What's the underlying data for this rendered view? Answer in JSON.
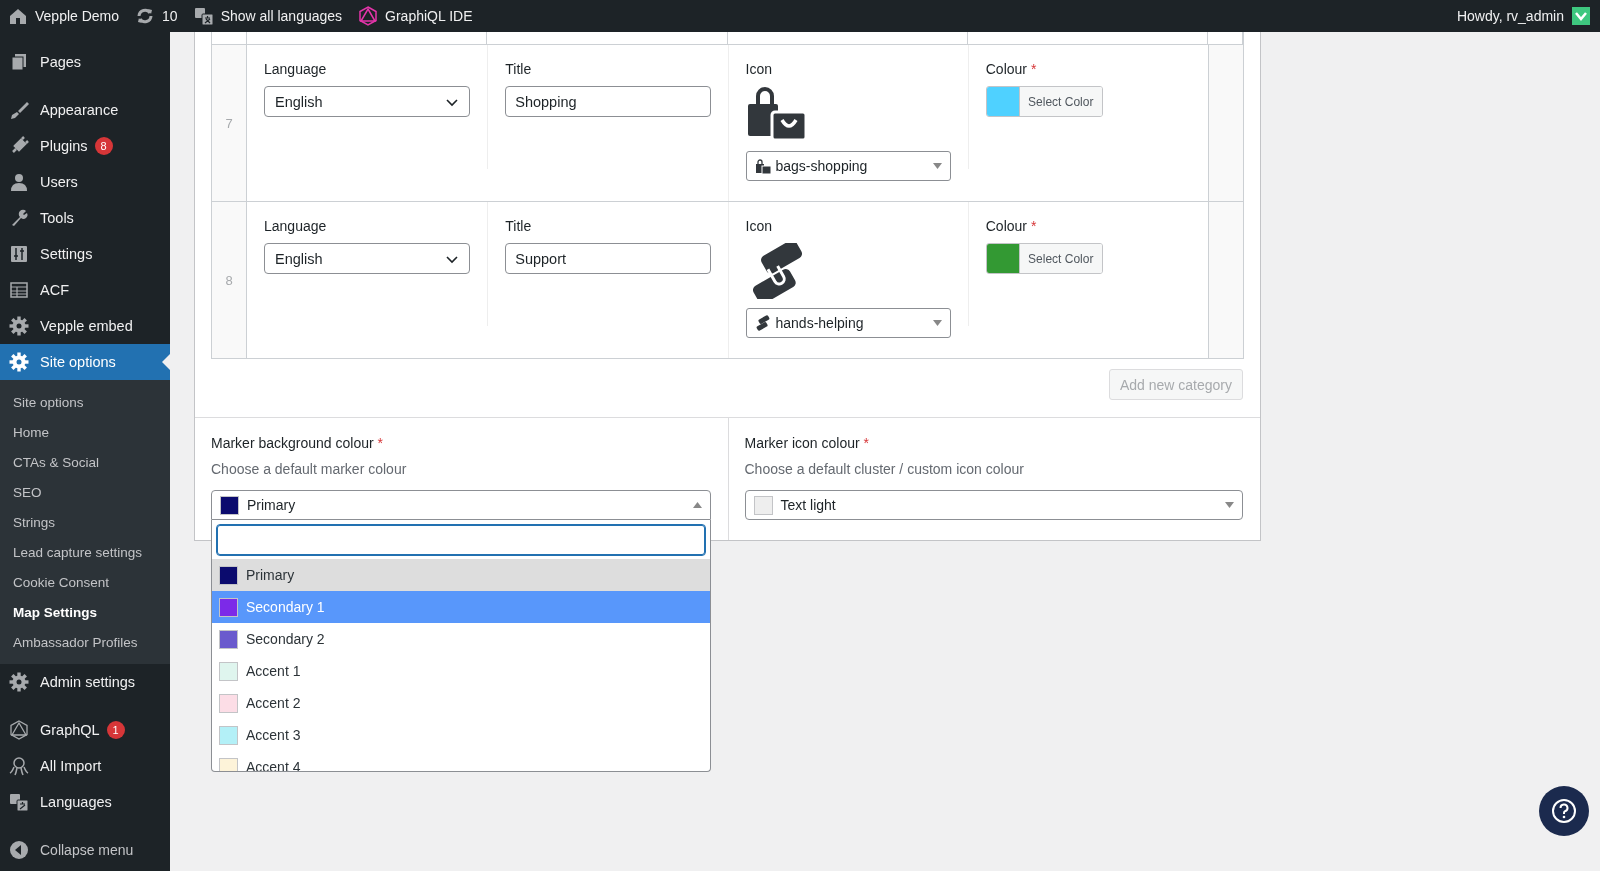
{
  "topbar": {
    "items": [
      {
        "label": "Vepple Demo"
      },
      {
        "label": "10"
      },
      {
        "label": "Show all languages"
      },
      {
        "label": "GraphiQL IDE"
      }
    ],
    "greeting": "Howdy, rv_admin"
  },
  "sidebar": {
    "groups": [
      [
        {
          "label": "Pages",
          "selected": false
        }
      ],
      [
        {
          "label": "Appearance",
          "selected": false
        },
        {
          "label": "Plugins",
          "badge": "8",
          "selected": false
        },
        {
          "label": "Users",
          "selected": false
        },
        {
          "label": "Tools",
          "selected": false
        },
        {
          "label": "Settings",
          "selected": false
        },
        {
          "label": "ACF",
          "selected": false
        },
        {
          "label": "Vepple embed",
          "selected": false
        },
        {
          "label": "Site options",
          "selected": true,
          "children": [
            {
              "label": "Site options",
              "selected": false
            },
            {
              "label": "Home",
              "selected": false
            },
            {
              "label": "CTAs & Social",
              "selected": false
            },
            {
              "label": "SEO",
              "selected": false
            },
            {
              "label": "Strings",
              "selected": false
            },
            {
              "label": "Lead capture settings",
              "selected": false
            },
            {
              "label": "Cookie Consent",
              "selected": false
            },
            {
              "label": "Map Settings",
              "selected": true
            },
            {
              "label": "Ambassador Profiles",
              "selected": false
            }
          ]
        },
        {
          "label": "Admin settings",
          "selected": false
        }
      ],
      [
        {
          "label": "GraphQL",
          "badge": "1",
          "selected": false
        },
        {
          "label": "All Import",
          "selected": false
        },
        {
          "label": "Languages",
          "selected": false
        }
      ]
    ],
    "collapse": "Collapse menu"
  },
  "rows": [
    {
      "number": "7",
      "language": {
        "label": "Language",
        "value": "English"
      },
      "title": {
        "label": "Title",
        "value": "Shopping"
      },
      "icon": {
        "label": "Icon",
        "value": "bags-shopping"
      },
      "colour": {
        "label": "Colour",
        "required": "*",
        "color": "#4fd1ff",
        "button": "Select Color"
      }
    },
    {
      "number": "8",
      "language": {
        "label": "Language",
        "value": "English"
      },
      "title": {
        "label": "Title",
        "value": "Support"
      },
      "icon": {
        "label": "Icon",
        "value": "hands-helping"
      },
      "colour": {
        "label": "Colour",
        "required": "*",
        "color": "#339933",
        "button": "Select Color"
      }
    }
  ],
  "add_button": {
    "label": "Add new category",
    "disabled": true
  },
  "marker_fields": [
    {
      "label": "Marker background colour",
      "required": "*",
      "description": "Choose a default marker colour",
      "value": "Primary",
      "color": "#0b0b6e",
      "expanded": true,
      "options": [
        {
          "label": "Primary",
          "color": "#0b0b6e",
          "selected": true,
          "highlighted": false
        },
        {
          "label": "Secondary 1",
          "color": "#7c2ae8",
          "selected": false,
          "highlighted": true
        },
        {
          "label": "Secondary 2",
          "color": "#6a5acd",
          "selected": false,
          "highlighted": false
        },
        {
          "label": "Accent 1",
          "color": "#dff5ee",
          "selected": false,
          "highlighted": false
        },
        {
          "label": "Accent 2",
          "color": "#fcdde6",
          "selected": false,
          "highlighted": false
        },
        {
          "label": "Accent 3",
          "color": "#b3f0f7",
          "selected": false,
          "highlighted": false
        },
        {
          "label": "Accent 4",
          "color": "#fdf3d9",
          "selected": false,
          "highlighted": false
        }
      ]
    },
    {
      "label": "Marker icon colour",
      "required": "*",
      "description": "Choose a default cluster / custom icon colour",
      "value": "Text light",
      "color": "#eeeeee",
      "expanded": false
    }
  ]
}
